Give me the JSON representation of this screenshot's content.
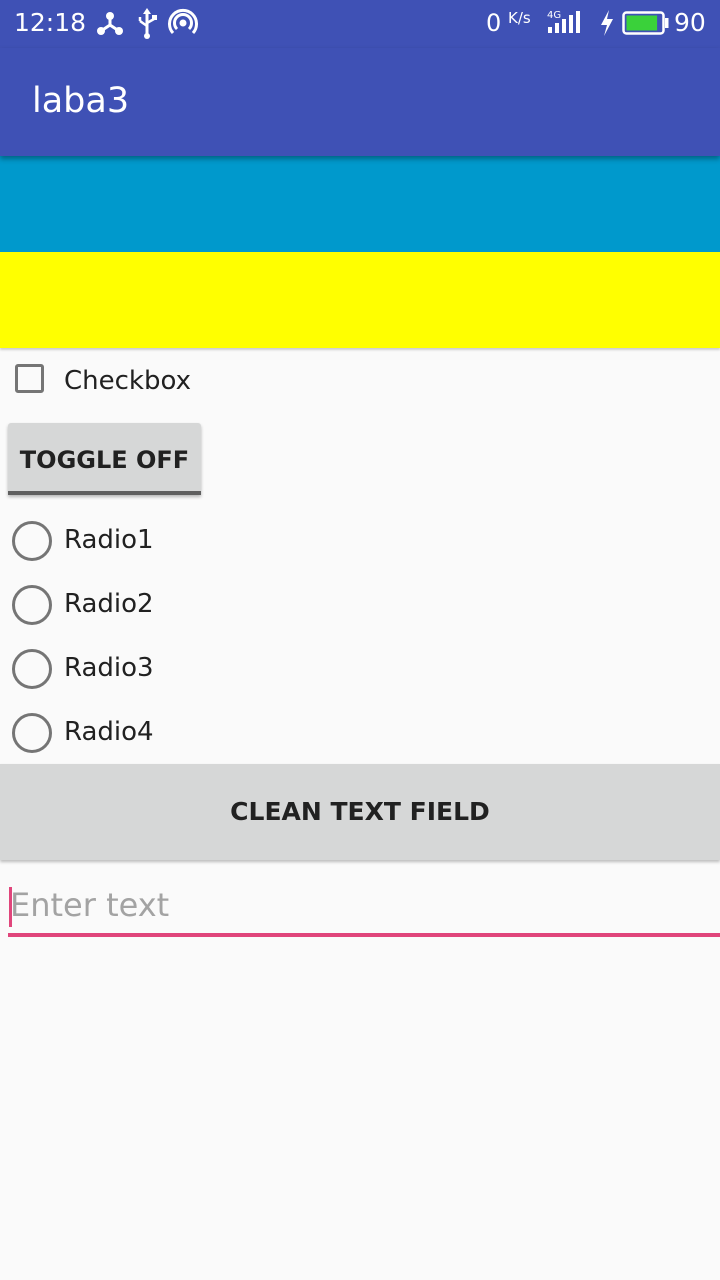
{
  "status_bar": {
    "time": "12:18",
    "net_speed_value": "0",
    "net_speed_unit": "K/s",
    "network_type": "4G",
    "battery_level": "90",
    "battery_fill": 0.9,
    "icons": [
      "share-icon",
      "usb-icon",
      "hotspot-icon",
      "signal-icon",
      "charging-icon",
      "battery-icon"
    ]
  },
  "app_bar": {
    "title": "laba3",
    "color": "#3f51b5"
  },
  "colors": {
    "stripe_top": "#0099cc",
    "stripe_bottom": "#ffff00",
    "accent": "#e0457b",
    "button_background": "#d6d7d7"
  },
  "checkbox": {
    "label": "Checkbox",
    "checked": false
  },
  "toggle_button": {
    "label": "TOGGLE OFF",
    "checked": false
  },
  "radios": [
    {
      "label": "Radio1",
      "checked": false
    },
    {
      "label": "Radio2",
      "checked": false
    },
    {
      "label": "Radio3",
      "checked": false
    },
    {
      "label": "Radio4",
      "checked": false
    }
  ],
  "clean_button": {
    "label": "CLEAN TEXT FIELD"
  },
  "text_field": {
    "value": "",
    "placeholder": "Enter text"
  }
}
